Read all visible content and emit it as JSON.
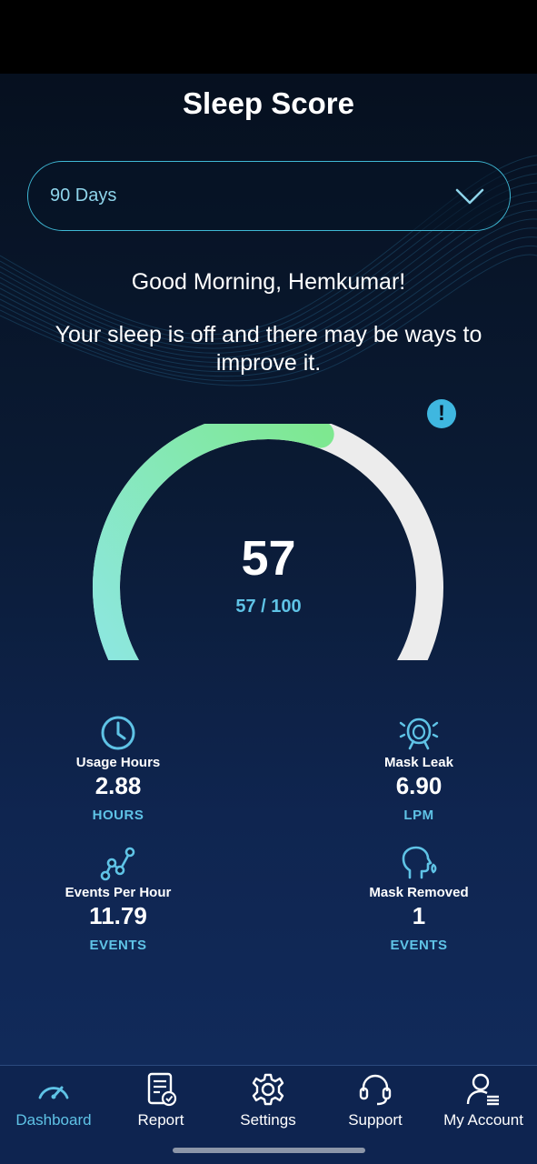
{
  "header": {
    "title": "Sleep Score"
  },
  "range_select": {
    "value": "90 Days",
    "icon": "chevron-down-icon"
  },
  "greeting": "Good Morning, Hemkumar!",
  "message": "Your sleep is off and there may be ways to improve it.",
  "info_icon": {
    "icon": "exclamation-icon",
    "glyph": "!"
  },
  "score": {
    "value": "57",
    "subtitle": "57 / 100",
    "fraction": 0.57,
    "colors": {
      "start": "#8ee7e6",
      "end": "#7ee890",
      "track": "#ececec"
    }
  },
  "metrics": [
    {
      "icon": "clock-icon",
      "label": "Usage Hours",
      "value": "2.88",
      "unit": "HOURS"
    },
    {
      "icon": "mask-leak-icon",
      "label": "Mask Leak",
      "value": "6.90",
      "unit": "LPM"
    },
    {
      "icon": "trend-graph-icon",
      "label": "Events Per Hour",
      "value": "11.79",
      "unit": "EVENTS"
    },
    {
      "icon": "head-mask-icon",
      "label": "Mask Removed",
      "value": "1",
      "unit": "EVENTS"
    }
  ],
  "tabs": [
    {
      "label": "Dashboard",
      "icon": "speedometer-icon",
      "active": true
    },
    {
      "label": "Report",
      "icon": "report-icon",
      "active": false
    },
    {
      "label": "Settings",
      "icon": "gear-icon",
      "active": false
    },
    {
      "label": "Support",
      "icon": "headset-icon",
      "active": false
    },
    {
      "label": "My Account",
      "icon": "account-icon",
      "active": false
    }
  ],
  "colors": {
    "accent": "#5fc3e6",
    "background_top": "#06101f",
    "background_bottom": "#112a5a",
    "tabbar": "#0e2450"
  }
}
